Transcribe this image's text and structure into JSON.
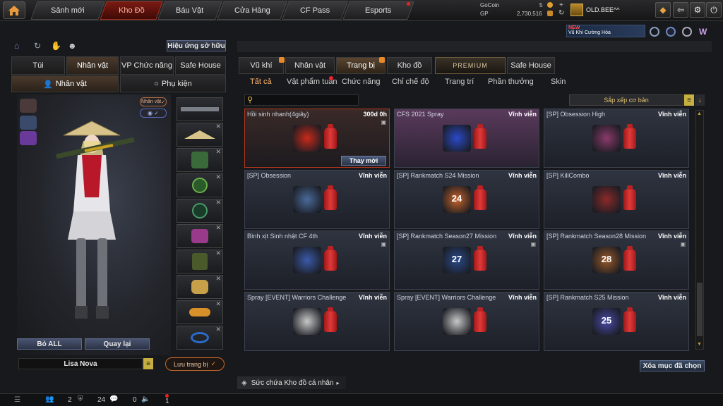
{
  "nav": {
    "tabs": [
      "Sảnh mới",
      "Kho Đồ",
      "Báu Vật",
      "Cửa Hàng",
      "CF Pass",
      "Esports"
    ],
    "active": "Kho Đồ"
  },
  "currency": {
    "gocoin_label": "GoCoin",
    "gocoin_value": "5",
    "gp_label": "GP",
    "gp_value": "2,730,516"
  },
  "user": {
    "name": "OLD.BEE^^"
  },
  "promo": {
    "badge": "NEW",
    "text": "Vũ Khí Cường Hóa"
  },
  "left": {
    "effect_button": "Hiệu ứng sở hữu",
    "tabs": [
      "Túi",
      "Nhân vật",
      "VP Chức năng",
      "Safe House"
    ],
    "subtabs": [
      "Nhân vật",
      "Phụ kiện"
    ],
    "char_tag": "Nhân vật",
    "remove_all": "Bỏ ALL",
    "back": "Quay lại",
    "char_name": "Lisa Nova",
    "save_btn": "Lưu trang bị"
  },
  "right": {
    "tabs": [
      "Vũ khí",
      "Nhân vật",
      "Trang bị",
      "Kho đồ",
      "PREMIUM",
      "Safe House"
    ],
    "subtabs": [
      "Tất cả",
      "Vật phẩm tuần",
      "Chức năng",
      "Chỉ chế độ",
      "Trang trí",
      "Phần thưởng",
      "Skin"
    ],
    "sort": "Sắp xếp cơ bản",
    "delete_btn": "Xóa mục đã chọn",
    "replace_btn": "Thay mới",
    "items": [
      {
        "name": "Hồi sinh nhanh(4giây)",
        "dur": "300d 0h",
        "icon": "speed-up-icon"
      },
      {
        "name": "CFS 2021 Spray",
        "dur": "Vĩnh viễn",
        "icon": "cfs-spray-icon"
      },
      {
        "name": "[SP] Obsession High",
        "dur": "Vĩnh viễn",
        "icon": "emblem-icon"
      },
      {
        "name": "[SP] Obsession",
        "dur": "Vĩnh viễn",
        "icon": "emblem-icon"
      },
      {
        "name": "[SP] Rankmatch S24 Mission",
        "dur": "Vĩnh viễn",
        "icon": "rank-24-icon",
        "rank": "24"
      },
      {
        "name": "[SP] KillCombo",
        "dur": "Vĩnh viễn",
        "icon": "killcombo-icon"
      },
      {
        "name": "Bình xịt Sinh nhật CF 4th",
        "dur": "Vĩnh viễn",
        "icon": "birthday-spray-icon"
      },
      {
        "name": "[SP] Rankmatch Season27 Mission",
        "dur": "Vĩnh viễn",
        "icon": "rank-27-icon",
        "rank": "27"
      },
      {
        "name": "[SP] Rankmatch Season28 Mission",
        "dur": "Vĩnh viễn",
        "icon": "rank-28-icon",
        "rank": "28"
      },
      {
        "name": "Spray [EVENT] Warriors Challenge",
        "dur": "Vĩnh viễn",
        "icon": "warrior-spray-icon"
      },
      {
        "name": "Spray [EVENT] Warriors Challenge",
        "dur": "Vĩnh viễn",
        "icon": "warrior-spray-icon"
      },
      {
        "name": "[SP] Rankmatch S25 Mission",
        "dur": "Vĩnh viễn",
        "icon": "rank-25-icon",
        "rank": "25"
      }
    ],
    "capacity": "Sức chứa Kho đồ cá nhân"
  },
  "bottom": {
    "v1": "2",
    "v2": "24",
    "v3": "0",
    "v4": "1"
  }
}
